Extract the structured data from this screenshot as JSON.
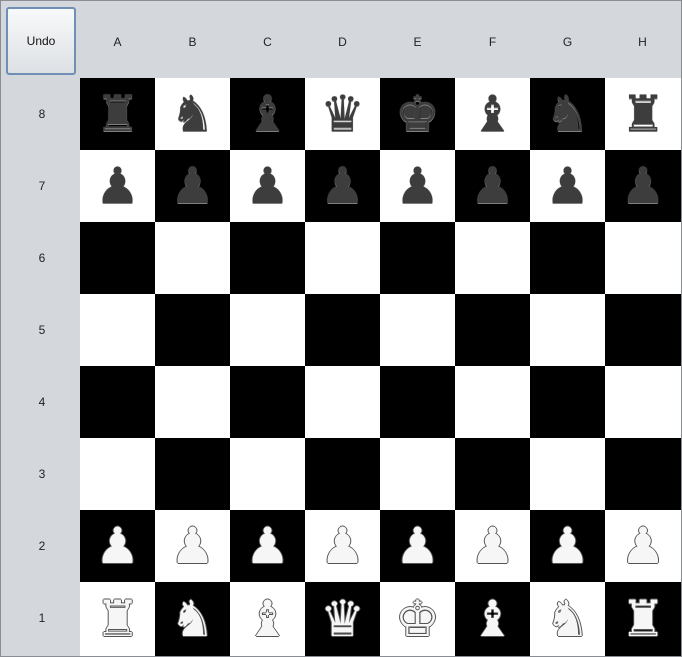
{
  "undo_label": "Undo",
  "files": [
    "A",
    "B",
    "C",
    "D",
    "E",
    "F",
    "G",
    "H"
  ],
  "ranks": [
    "8",
    "7",
    "6",
    "5",
    "4",
    "3",
    "2",
    "1"
  ],
  "colors": {
    "light_square": "#ffffff",
    "dark_square": "#000000",
    "panel": "#d4d8dc"
  },
  "board": [
    [
      "br",
      "bn",
      "bb",
      "bq",
      "bk",
      "bb",
      "bn",
      "br"
    ],
    [
      "bp",
      "bp",
      "bp",
      "bp",
      "bp",
      "bp",
      "bp",
      "bp"
    ],
    [
      "",
      "",
      "",
      "",
      "",
      "",
      "",
      ""
    ],
    [
      "",
      "",
      "",
      "",
      "",
      "",
      "",
      ""
    ],
    [
      "",
      "",
      "",
      "",
      "",
      "",
      "",
      ""
    ],
    [
      "",
      "",
      "",
      "",
      "",
      "",
      "",
      ""
    ],
    [
      "wp",
      "wp",
      "wp",
      "wp",
      "wp",
      "wp",
      "wp",
      "wp"
    ],
    [
      "wr",
      "wn",
      "wb",
      "wq",
      "wk",
      "wb",
      "wn",
      "wr"
    ]
  ],
  "piece_icons": {
    "k": "king-icon",
    "q": "queen-icon",
    "r": "rook-icon",
    "b": "bishop-icon",
    "n": "knight-icon",
    "p": "pawn-icon"
  }
}
